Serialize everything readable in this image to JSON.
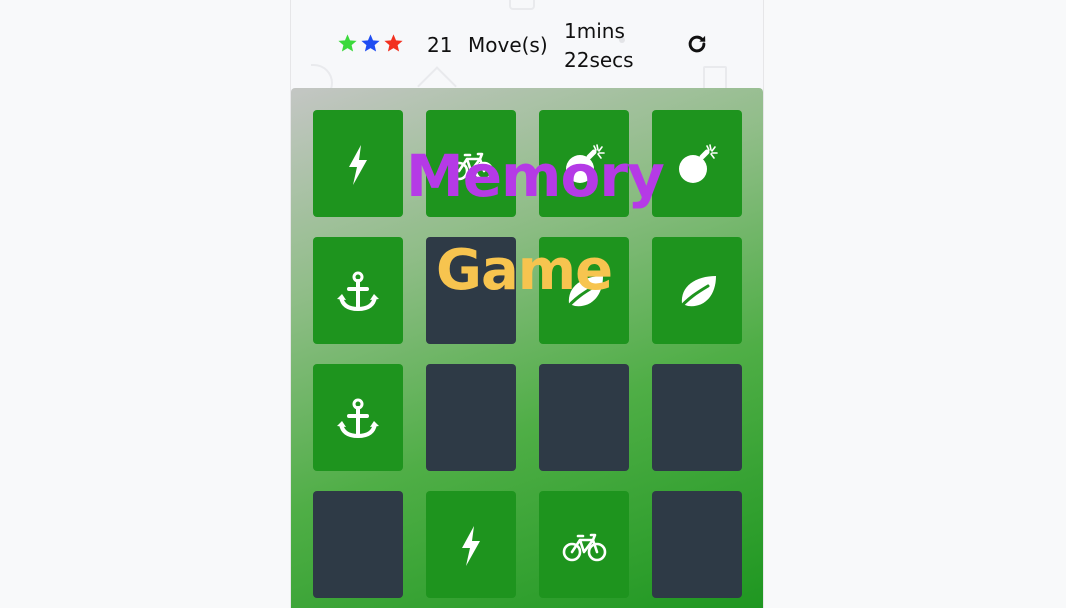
{
  "score_panel": {
    "stars": [
      {
        "icon": "star-icon",
        "color": "#3bd93b"
      },
      {
        "icon": "star-icon",
        "color": "#1f4df2"
      },
      {
        "icon": "star-icon",
        "color": "#f2301f"
      }
    ],
    "moves_count": "21",
    "moves_label": "Move(s)",
    "timer_minutes": "1mins",
    "timer_seconds": "22secs",
    "restart_icon": "refresh-icon"
  },
  "overlay_title": {
    "line1": "Memory",
    "line2": "Game",
    "line1_color": "#b53ae6",
    "line2_color": "#f7c44f"
  },
  "deck": {
    "columns": 4,
    "rows": 4,
    "cards": [
      {
        "state": "match",
        "icon": "bolt-icon"
      },
      {
        "state": "match",
        "icon": "bicycle-icon"
      },
      {
        "state": "match",
        "icon": "bomb-icon"
      },
      {
        "state": "match",
        "icon": "bomb-icon"
      },
      {
        "state": "match",
        "icon": "anchor-icon"
      },
      {
        "state": "hidden",
        "icon": ""
      },
      {
        "state": "match",
        "icon": "leaf-icon"
      },
      {
        "state": "match",
        "icon": "leaf-icon"
      },
      {
        "state": "match",
        "icon": "anchor-icon"
      },
      {
        "state": "hidden",
        "icon": ""
      },
      {
        "state": "hidden",
        "icon": ""
      },
      {
        "state": "hidden",
        "icon": ""
      },
      {
        "state": "hidden",
        "icon": ""
      },
      {
        "state": "match",
        "icon": "bolt-icon"
      },
      {
        "state": "match",
        "icon": "bicycle-icon"
      },
      {
        "state": "hidden",
        "icon": ""
      }
    ]
  },
  "colors": {
    "matched_card": "#1e941e",
    "hidden_card": "#2e3a46"
  }
}
